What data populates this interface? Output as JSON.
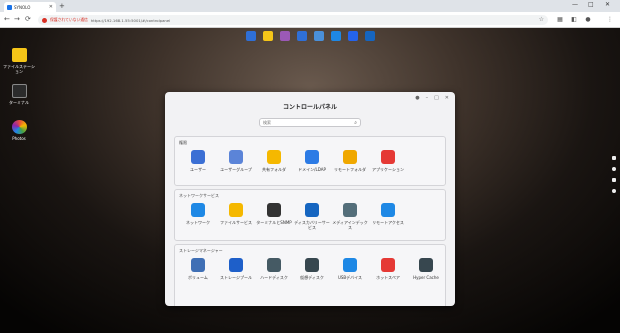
{
  "browser": {
    "tab_title": "SYNOLO",
    "new_tab": "+",
    "controls": {
      "minimize": "—",
      "maximize": "□",
      "close": "✕"
    },
    "nav": {
      "back": "←",
      "forward": "→",
      "reload": "⟳"
    },
    "security_warning": "保護されていない通信",
    "url": "https://192.168.1.55:5001/#/controlpanel"
  },
  "desktop_icons": [
    {
      "label": "ファイルステーション",
      "color": "#f5c518"
    },
    {
      "label": "ターミナル",
      "color": "#2b2b2b"
    },
    {
      "label": "Photos",
      "color": "#e84c3d"
    }
  ],
  "dock_colors": [
    "#2f6fd6",
    "#f5c518",
    "#9b59b6",
    "#2f6fd6",
    "#4a90d9",
    "#1e88e5",
    "#2563eb",
    "#1565c0"
  ],
  "window": {
    "title": "コントロールパネル",
    "search_placeholder": "検索"
  },
  "sections": [
    {
      "title": "権限",
      "items": [
        {
          "label": "ユーザー",
          "color": "#3b6fd4"
        },
        {
          "label": "ユーザーグループ",
          "color": "#5b84d8"
        },
        {
          "label": "共有フォルダ",
          "color": "#f5b800"
        },
        {
          "label": "ドメイン/LDAP",
          "color": "#2c7be5"
        },
        {
          "label": "リモートフォルダ",
          "color": "#f0a800"
        },
        {
          "label": "アプリケーション",
          "color": "#e53935"
        }
      ]
    },
    {
      "title": "ネットワークサービス",
      "items": [
        {
          "label": "ネットワーク",
          "color": "#1e88e5"
        },
        {
          "label": "ファイルサービス",
          "color": "#f5b800"
        },
        {
          "label": "ターミナルとSNMP",
          "color": "#333333"
        },
        {
          "label": "ディスカバリーサービス",
          "color": "#1565c0"
        },
        {
          "label": "メディアインデックス",
          "color": "#546e7a"
        },
        {
          "label": "リモートアクセス",
          "color": "#1e88e5"
        }
      ]
    },
    {
      "title": "ストレージマネージャー",
      "items": [
        {
          "label": "ボリューム",
          "color": "#3f6fb5"
        },
        {
          "label": "ストレージプール",
          "color": "#1e5fc9"
        },
        {
          "label": "ハードディスク",
          "color": "#455a64"
        },
        {
          "label": "仮想ディスク",
          "color": "#37474f"
        },
        {
          "label": "USBデバイス",
          "color": "#1e88e5"
        },
        {
          "label": "ホットスペア",
          "color": "#e53935"
        },
        {
          "label": "Hyper Cache",
          "color": "#37474f"
        }
      ]
    }
  ]
}
